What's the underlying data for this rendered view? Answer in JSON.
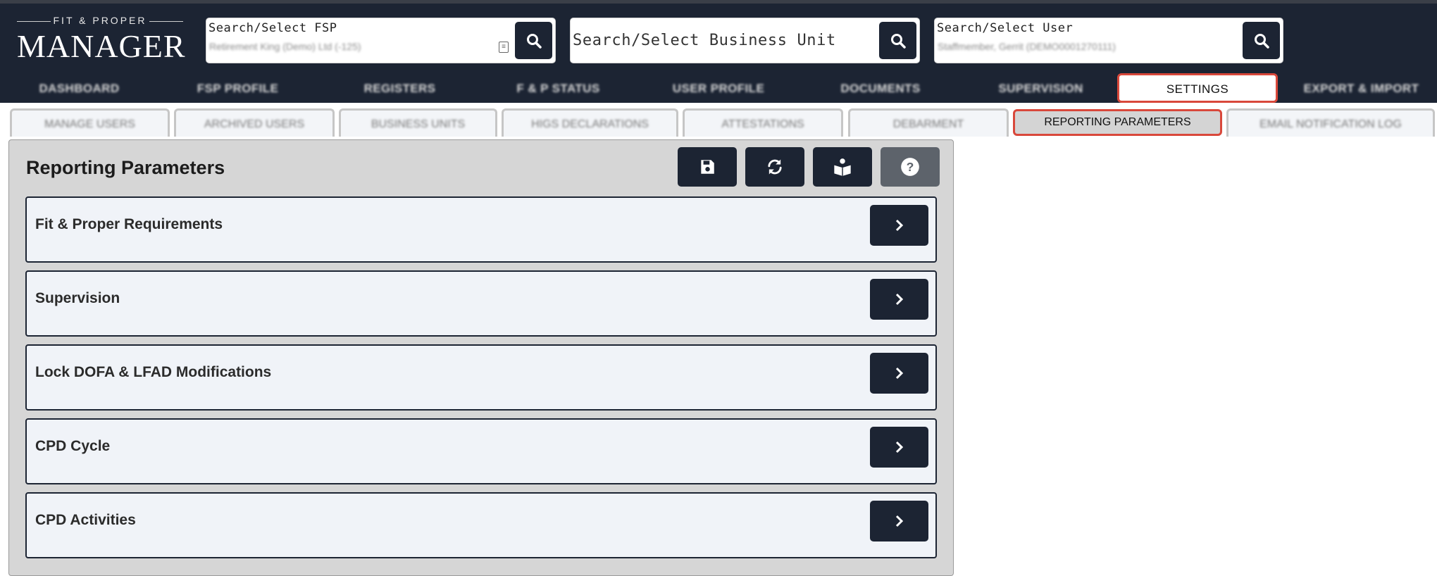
{
  "logo": {
    "tagline": "FIT & PROPER",
    "name": "MANAGER"
  },
  "search_fsp": {
    "caption": "Search/Select FSP",
    "value": "Retirement King (Demo) Ltd (-125)",
    "icon": "search-icon"
  },
  "search_business_unit": {
    "placeholder": "Search/Select Business Unit",
    "icon": "search-icon"
  },
  "search_user": {
    "caption": "Search/Select User",
    "value": "Staffmember, Gerrit (DEMO0001270111)",
    "icon": "search-icon"
  },
  "nav": {
    "items": [
      {
        "label": "DASHBOARD"
      },
      {
        "label": "FSP PROFILE"
      },
      {
        "label": "REGISTERS"
      },
      {
        "label": "F & P STATUS"
      },
      {
        "label": "USER PROFILE"
      },
      {
        "label": "DOCUMENTS"
      },
      {
        "label": "SUPERVISION"
      },
      {
        "label": "SETTINGS"
      },
      {
        "label": "EXPORT & IMPORT"
      }
    ],
    "active": "SETTINGS"
  },
  "subnav": {
    "tabs": [
      {
        "label": "MANAGE USERS"
      },
      {
        "label": "ARCHIVED USERS"
      },
      {
        "label": "BUSINESS UNITS"
      },
      {
        "label": "HIGS DECLARATIONS"
      },
      {
        "label": "ATTESTATIONS"
      },
      {
        "label": "DEBARMENT"
      },
      {
        "label": "REPORTING PARAMETERS"
      },
      {
        "label": "EMAIL NOTIFICATION LOG"
      }
    ],
    "active": "REPORTING PARAMETERS"
  },
  "panel": {
    "title": "Reporting Parameters",
    "toolbar": [
      "save-icon",
      "refresh-icon",
      "manual-icon",
      "help-icon"
    ],
    "sections": [
      {
        "label": "Fit & Proper Requirements"
      },
      {
        "label": "Supervision"
      },
      {
        "label": "Lock DOFA & LFAD Modifications"
      },
      {
        "label": "CPD Cycle"
      },
      {
        "label": "CPD Activities"
      }
    ]
  },
  "colors": {
    "navy": "#1c2433",
    "highlight": "#d9483b",
    "panel": "#d6d6d6",
    "row": "#f0f3f8"
  }
}
